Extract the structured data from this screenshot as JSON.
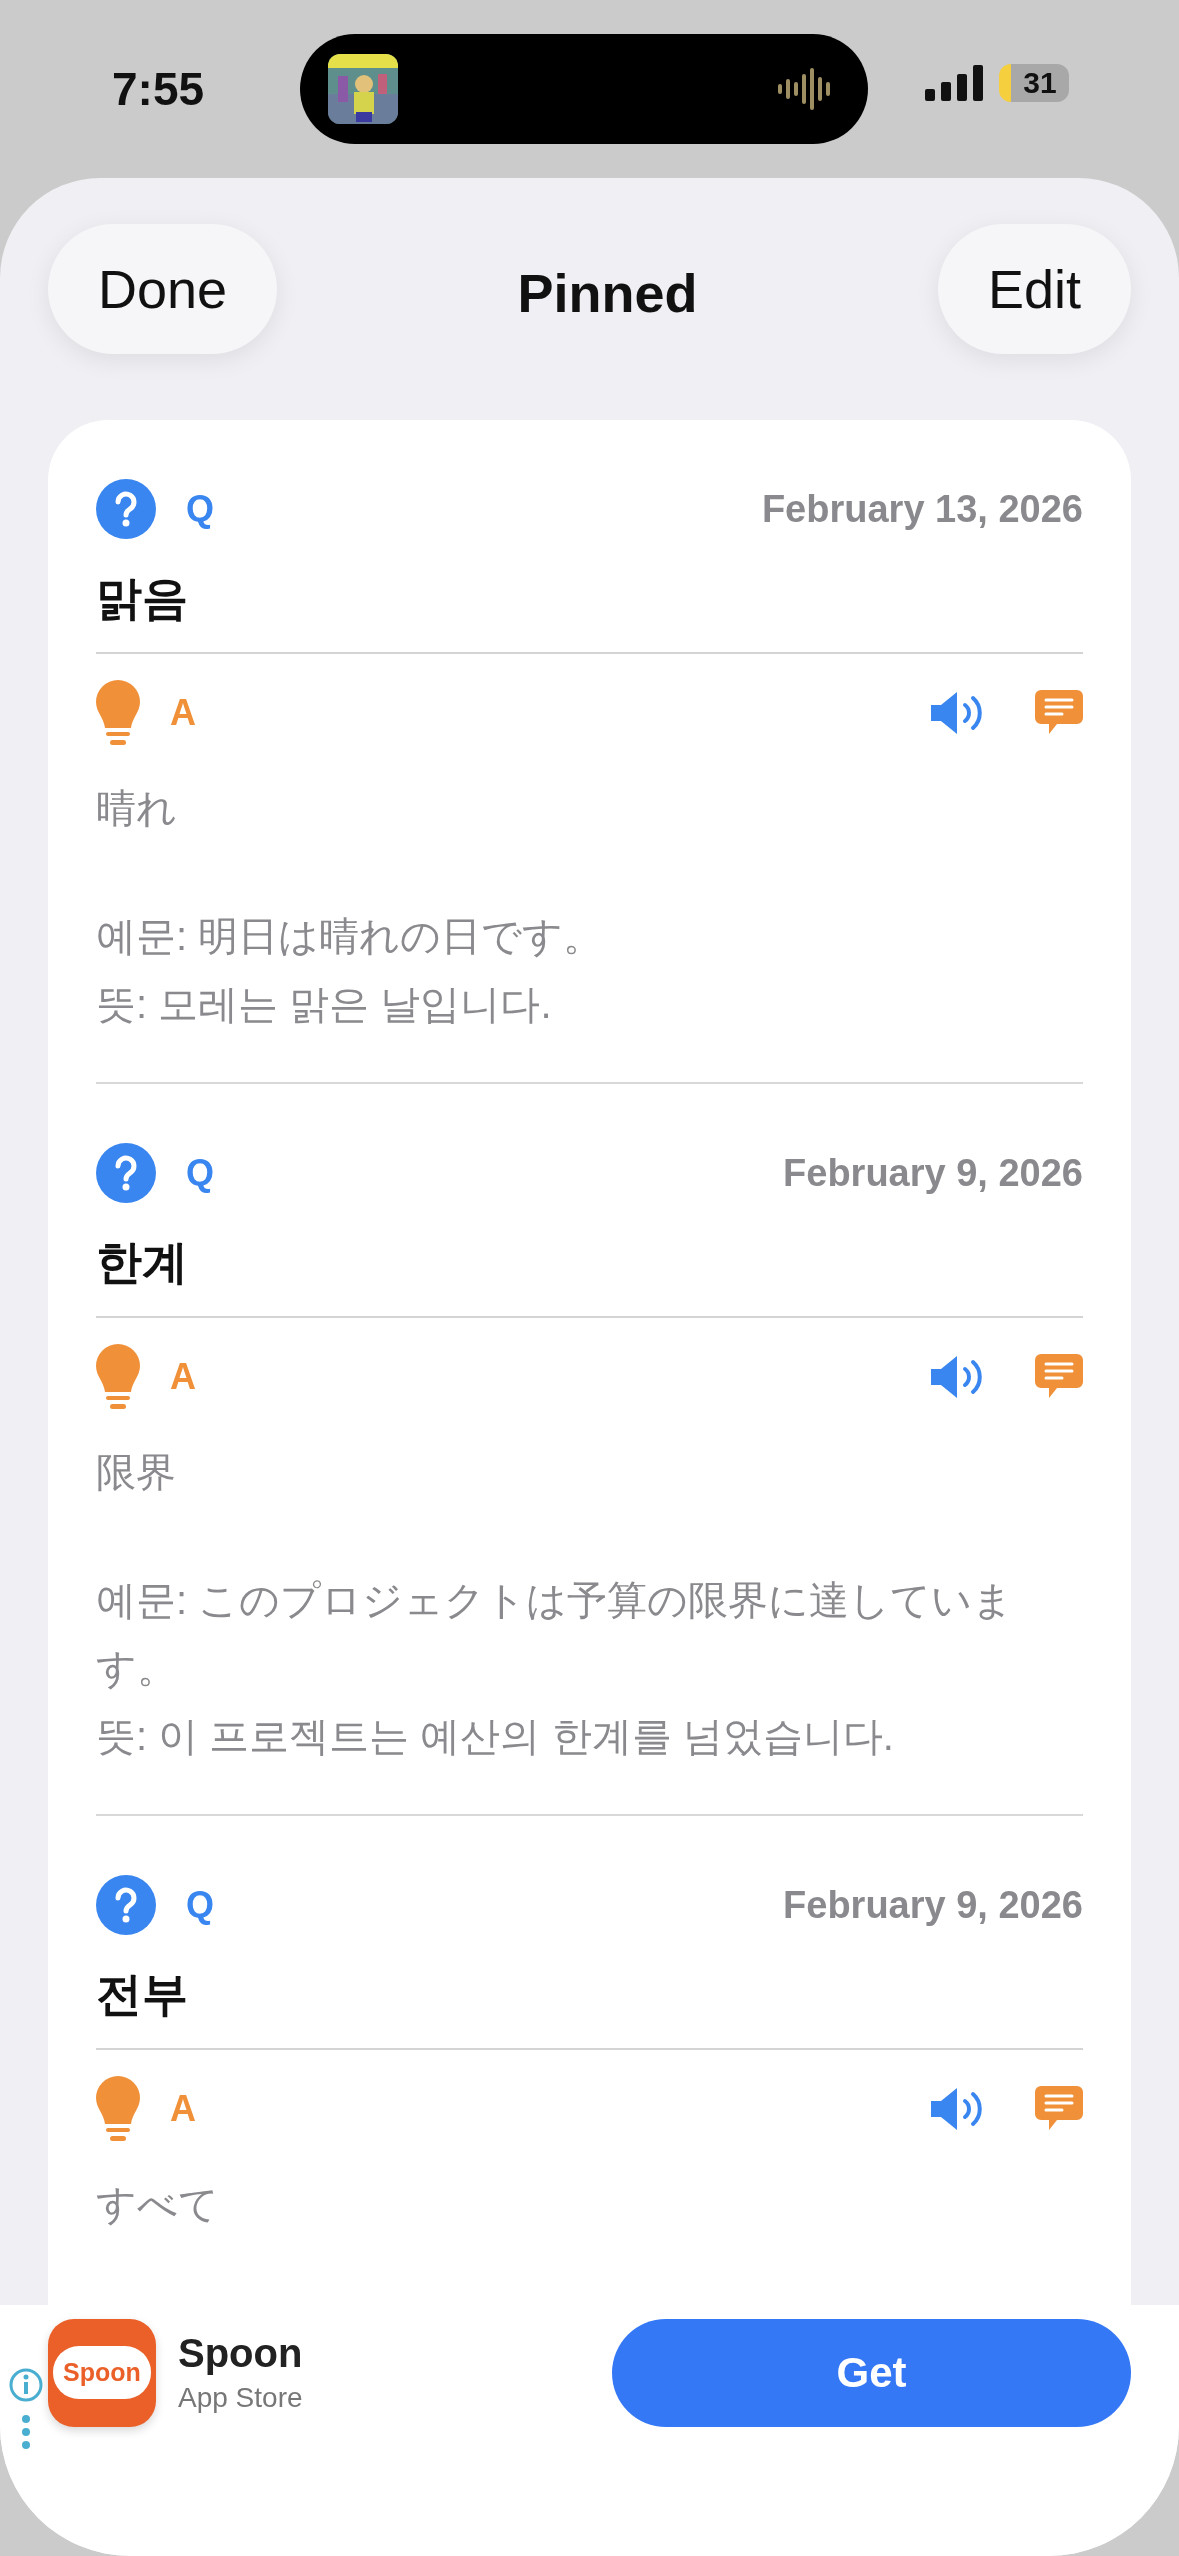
{
  "status_bar": {
    "time": "7:55",
    "battery": "31"
  },
  "header": {
    "left_button": "Done",
    "title": "Pinned",
    "right_button": "Edit"
  },
  "entries": [
    {
      "q_label": "Q",
      "date": "February 13, 2026",
      "word": "맑음",
      "a_label": "A",
      "answer": "晴れ",
      "example": [
        "예문: 明日は晴れの日です。",
        "뜻: 모레는 맑은 날입니다."
      ]
    },
    {
      "q_label": "Q",
      "date": "February 9, 2026",
      "word": "한계",
      "a_label": "A",
      "answer": "限界",
      "example": [
        "예문: このプロジェクトは予算の限界に達しています。",
        "뜻: 이 프로젝트는 예산의 한계를 넘었습니다."
      ]
    },
    {
      "q_label": "Q",
      "date": "February 9, 2026",
      "word": "전부",
      "a_label": "A",
      "answer": "すべて"
    }
  ],
  "ad": {
    "logo_text": "Spoon",
    "app_name": "Spoon",
    "store": "App Store",
    "button": "Get"
  }
}
